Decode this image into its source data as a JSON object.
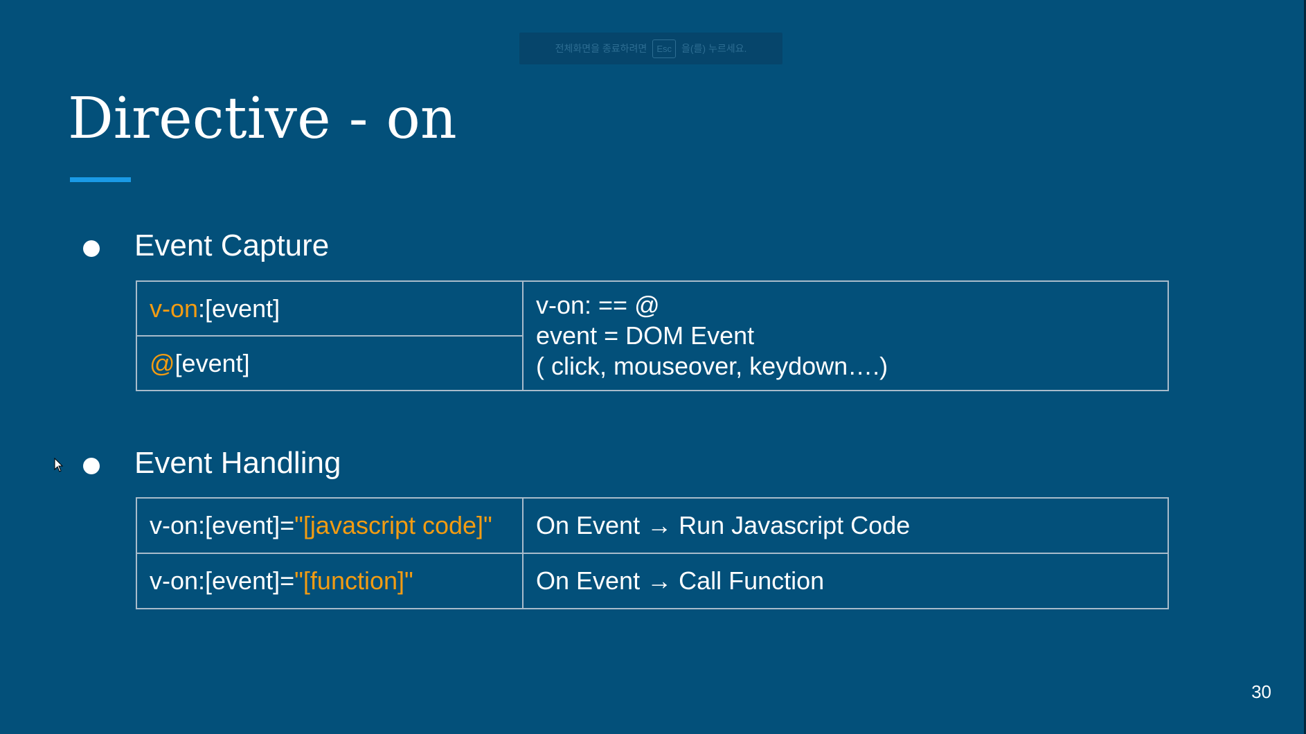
{
  "fullscreen_notice": {
    "before": "전체화면을 종료하려면",
    "key": "Esc",
    "after": "을(를) 누르세요."
  },
  "slide": {
    "title": "Directive - on",
    "page_number": "30",
    "accent_color": "#1a9ae6",
    "background_color": "#03507a",
    "highlight_color": "#f39c12"
  },
  "event_capture": {
    "heading": "Event Capture",
    "rows": [
      {
        "prefix": "v-on",
        "rest": ":[event]"
      },
      {
        "prefix": "@",
        "rest": "[event]"
      }
    ],
    "description": [
      "v-on: == @",
      "event = DOM Event",
      "( click, mouseover, keydown….)"
    ]
  },
  "event_handling": {
    "heading": "Event Handling",
    "rows": [
      {
        "prefix": "v-on:[event]=",
        "value": "\"[javascript code]\"",
        "description": "On Event → Run Javascript Code"
      },
      {
        "prefix": "v-on:[event]=",
        "value": "\"[function]\"",
        "description": "On Event → Call Function"
      }
    ]
  },
  "icons": {
    "cursor": "mouse-pointer-icon",
    "bullet": "bullet-dot-icon"
  }
}
